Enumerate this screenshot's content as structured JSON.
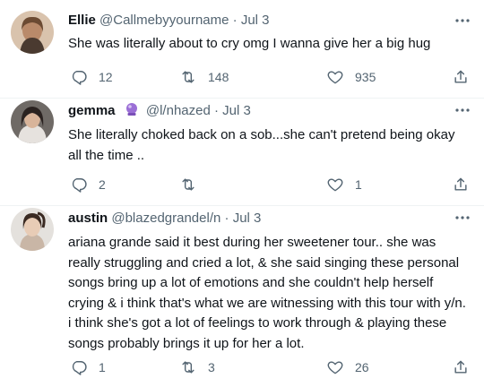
{
  "tweets": [
    {
      "name": "Ellie",
      "handle": "@Callmebyyourname",
      "separator": "·",
      "date": "Jul 3",
      "text": "She was literally about to cry omg I wanna give her a big hug",
      "replies": "12",
      "retweets": "148",
      "likes": "935",
      "avatar_color": "#c9a98f",
      "avatar_icon": "avatar-photo"
    },
    {
      "name": "gemma",
      "name_emoji": "crystal-ball-icon",
      "handle": "@l/nhazed",
      "separator": "·",
      "date": "Jul 3",
      "text": "She literally choked back on a sob...she can't pretend being okay all the time ..",
      "replies": "2",
      "retweets": "",
      "likes": "1",
      "avatar_color": "#3b3b3b",
      "avatar_icon": "avatar-photo"
    },
    {
      "name": "austin",
      "handle": "@blazedgrandel/n",
      "separator": "·",
      "date": "Jul 3",
      "text": "ariana grande said it best during her sweetener tour.. she was really struggling and cried a lot, & she said singing these personal songs bring up a lot of emotions and she couldn't help herself crying & i think that's what we are witnessing with this tour with y/n. i think she's got a lot of feelings to work through & playing these songs probably brings it up for her a lot.",
      "replies": "1",
      "retweets": "3",
      "likes": "26",
      "avatar_color": "#d8d4d0",
      "avatar_icon": "avatar-photo"
    }
  ],
  "colors": {
    "text_primary": "#0f1419",
    "text_secondary": "#536471",
    "divider": "#eff3f4"
  }
}
